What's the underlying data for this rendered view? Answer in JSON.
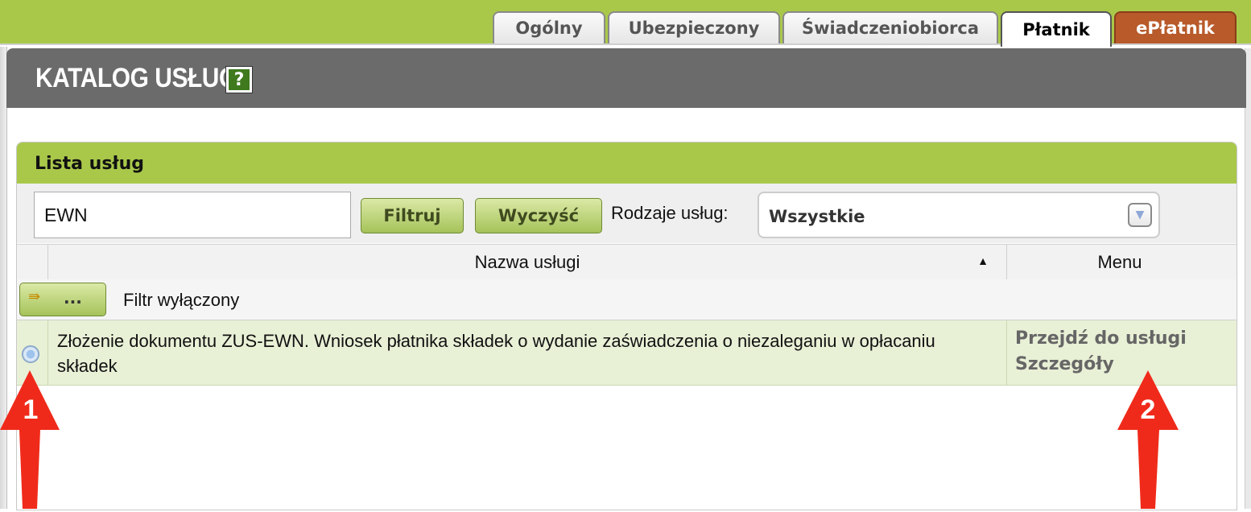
{
  "tabs": [
    {
      "label": "Ogólny"
    },
    {
      "label": "Ubezpieczony"
    },
    {
      "label": "Świadczeniobiorca"
    },
    {
      "label": "Płatnik",
      "active": true
    },
    {
      "label": "ePłatnik"
    }
  ],
  "panel": {
    "title": "KATALOG USŁUG",
    "help_icon": "?"
  },
  "list": {
    "title": "Lista usług",
    "search": {
      "value": "EWN"
    },
    "filter_button": "Filtruj",
    "clear_button": "Wyczyść",
    "type_label": "Rodzaje usług:",
    "type_select": {
      "value": "Wszystkie"
    },
    "columns": {
      "name": "Nazwa usługi",
      "menu": "Menu",
      "sort": "ascending"
    },
    "filter_button_label": "...",
    "filter_status": "Filtr wyłączony",
    "rows": [
      {
        "name": "Złożenie dokumentu ZUS-EWN. Wniosek płatnika składek o wydanie zaświadczenia o niezaleganiu w opłacaniu składek",
        "menu_go": "Przejdź do usługi",
        "menu_details": "Szczegóły"
      }
    ]
  },
  "annotations": [
    "1",
    "2"
  ],
  "colors": {
    "brand_green": "#a9c84a",
    "header_gray": "#6b6b6b",
    "tab_red": "#b85a2a",
    "row_highlight": "#e8f0d6",
    "arrow_red": "#f02a1a"
  },
  "icons": [
    "help-icon",
    "filter-toggle-icon",
    "sort-ascending-icon",
    "dropdown-arrow-icon",
    "radio-icon"
  ]
}
